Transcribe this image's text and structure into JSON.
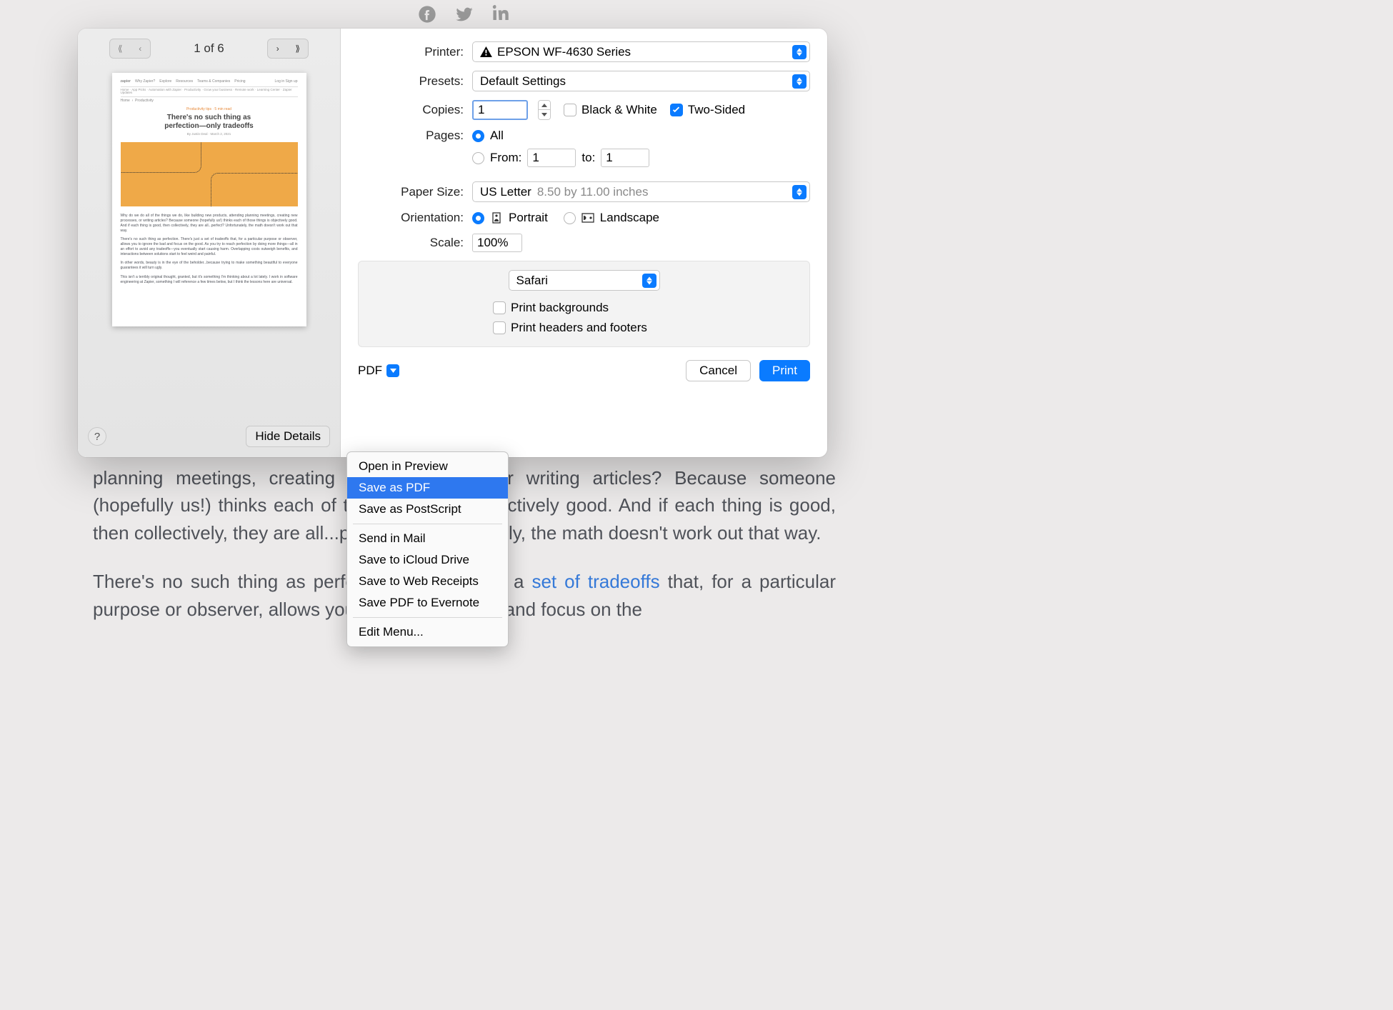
{
  "background": {
    "paragraph1": "planning meetings, creating new processes, or writing articles? Because someone (hopefully us!) thinks each of those things is objectively good. And if each thing is good, then collectively, they are all...perfect? Unfortunately, the math doesn't work out that way.",
    "paragraph2_pre": "There's no such thing as perfection. There's just a ",
    "paragraph2_link": "set of tradeoffs",
    "paragraph2_post": " that, for a particular purpose or observer, allows you to ignore the bad and focus on the"
  },
  "preview": {
    "page_label": "1 of 6",
    "thumb": {
      "brand": "zapier",
      "tag": "Productivity tips · 5 min read",
      "title_line1": "There's no such thing as",
      "title_line2": "perfection—only tradeoffs",
      "byline": "By Justin Deal · March 2, 2021"
    }
  },
  "footer": {
    "hide_details": "Hide Details",
    "pdf": "PDF",
    "cancel": "Cancel",
    "print": "Print"
  },
  "form": {
    "printer_label": "Printer:",
    "printer_value": "EPSON WF-4630 Series",
    "presets_label": "Presets:",
    "presets_value": "Default Settings",
    "copies_label": "Copies:",
    "copies_value": "1",
    "bw_label": "Black & White",
    "twosided_label": "Two-Sided",
    "pages_label": "Pages:",
    "pages_all": "All",
    "pages_from": "From:",
    "pages_from_val": "1",
    "pages_to": "to:",
    "pages_to_val": "1",
    "paper_label": "Paper Size:",
    "paper_value": "US Letter",
    "paper_dim": "8.50 by 11.00 inches",
    "orient_label": "Orientation:",
    "orient_portrait": "Portrait",
    "orient_landscape": "Landscape",
    "scale_label": "Scale:",
    "scale_value": "100%",
    "app_select": "Safari",
    "print_backgrounds": "Print backgrounds",
    "print_headers": "Print headers and footers"
  },
  "pdf_menu": {
    "open_preview": "Open in Preview",
    "save_pdf": "Save as PDF",
    "save_ps": "Save as PostScript",
    "send_mail": "Send in Mail",
    "save_icloud": "Save to iCloud Drive",
    "save_web": "Save to Web Receipts",
    "save_evernote": "Save PDF to Evernote",
    "edit_menu": "Edit Menu..."
  }
}
